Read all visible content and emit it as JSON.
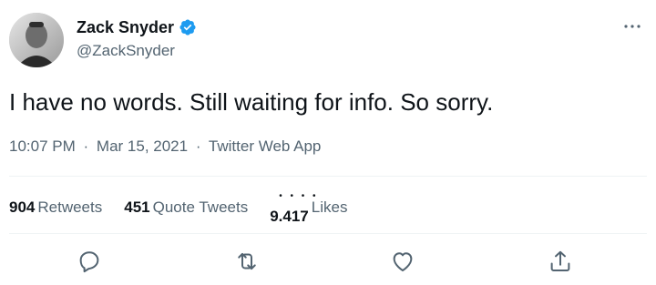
{
  "author": {
    "display_name": "Zack Snyder",
    "handle": "@ZackSnyder",
    "verified_icon": "verified-badge-icon"
  },
  "tweet": {
    "text": "I have no words. Still waiting for info. So sorry.",
    "time": "10:07 PM",
    "date": "Mar 15, 2021",
    "source": "Twitter Web App",
    "separator": "·"
  },
  "stats": {
    "retweets_count": "904",
    "retweets_label": "Retweets",
    "quotes_count": "451",
    "quotes_label": "Quote Tweets",
    "likes_count": "9.417",
    "likes_label": "Likes"
  },
  "actions": {
    "reply": "reply-icon",
    "retweet": "retweet-icon",
    "like": "like-icon",
    "share": "share-icon"
  },
  "colors": {
    "text_primary": "#0f1419",
    "text_secondary": "#536471",
    "verified_blue": "#1d9bf0",
    "divider": "#eff3f4"
  }
}
